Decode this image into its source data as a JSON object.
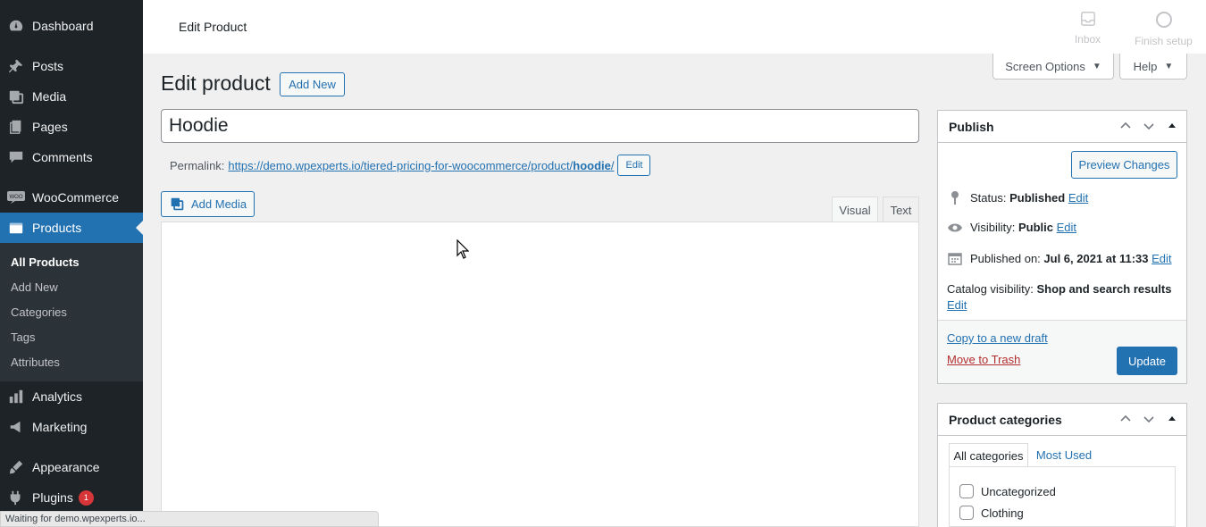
{
  "sidebar": {
    "items": [
      {
        "label": "Dashboard",
        "icon": "dashboard-icon"
      },
      {
        "label": "Posts",
        "icon": "pin-icon"
      },
      {
        "label": "Media",
        "icon": "media-icon"
      },
      {
        "label": "Pages",
        "icon": "pages-icon"
      },
      {
        "label": "Comments",
        "icon": "comment-icon"
      },
      {
        "label": "WooCommerce",
        "icon": "woo-icon"
      },
      {
        "label": "Products",
        "icon": "products-icon"
      },
      {
        "label": "Analytics",
        "icon": "analytics-icon"
      },
      {
        "label": "Marketing",
        "icon": "megaphone-icon"
      },
      {
        "label": "Appearance",
        "icon": "brush-icon"
      },
      {
        "label": "Plugins",
        "icon": "plug-icon",
        "badge": "1"
      }
    ],
    "submenu": [
      "All Products",
      "Add New",
      "Categories",
      "Tags",
      "Attributes"
    ]
  },
  "topbar": {
    "title": "Edit Product",
    "inbox": "Inbox",
    "finish_setup": "Finish setup"
  },
  "screen_options": "Screen Options",
  "help": "Help",
  "heading": "Edit product",
  "add_new": "Add New",
  "title_value": "Hoodie",
  "permalink": {
    "label": "Permalink:",
    "url_base": "https://demo.wpexperts.io/tiered-pricing-for-woocommerce/product/",
    "slug": "hoodie",
    "url_end": "/",
    "edit": "Edit"
  },
  "editor": {
    "add_media": "Add Media",
    "tab_visual": "Visual",
    "tab_text": "Text"
  },
  "publish": {
    "title": "Publish",
    "preview": "Preview Changes",
    "status_label": "Status:",
    "status_value": "Published",
    "visibility_label": "Visibility:",
    "visibility_value": "Public",
    "published_label": "Published on:",
    "published_value": "Jul 6, 2021 at 11:33",
    "catalog_label": "Catalog visibility:",
    "catalog_value": "Shop and search results",
    "edit": "Edit",
    "copy_draft": "Copy to a new draft",
    "trash": "Move to Trash",
    "update": "Update"
  },
  "categories": {
    "title": "Product categories",
    "tab_all": "All categories",
    "tab_used": "Most Used",
    "items": [
      "Uncategorized",
      "Clothing"
    ]
  },
  "statusbar": "Waiting for demo.wpexperts.io..."
}
